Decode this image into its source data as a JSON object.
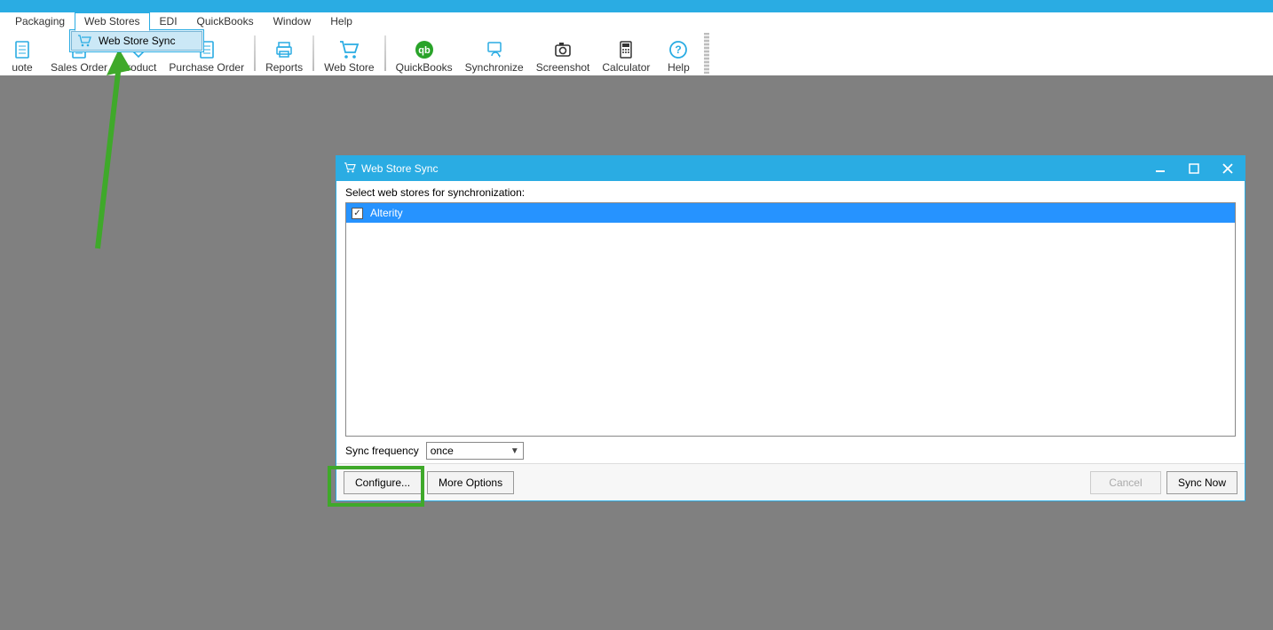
{
  "menubar": {
    "items": [
      {
        "label": "Packaging"
      },
      {
        "label": "Web Stores"
      },
      {
        "label": "EDI"
      },
      {
        "label": "QuickBooks"
      },
      {
        "label": "Window"
      },
      {
        "label": "Help"
      }
    ],
    "dropdown": {
      "item_label": "Web Store Sync"
    }
  },
  "toolbar": {
    "items": [
      {
        "name": "quote-button",
        "label": "uote",
        "color": "#2aace3",
        "icon": "doc"
      },
      {
        "name": "sales-order-button",
        "label": "Sales Order",
        "color": "#2aace3",
        "icon": "doc"
      },
      {
        "name": "product-button",
        "label": "Product",
        "color": "#2aace3",
        "icon": "tag"
      },
      {
        "name": "purchase-order-button",
        "label": "Purchase Order",
        "color": "#2aace3",
        "icon": "doc"
      },
      {
        "name": "reports-button",
        "label": "Reports",
        "color": "#2aace3",
        "icon": "printer",
        "sep_before": true
      },
      {
        "name": "web-store-button",
        "label": "Web Store",
        "color": "#2aace3",
        "icon": "cart",
        "sep_before": true
      },
      {
        "name": "quickbooks-button",
        "label": "QuickBooks",
        "color": "#29a329",
        "icon": "qb",
        "sep_before": true
      },
      {
        "name": "synchronize-button",
        "label": "Synchronize",
        "color": "#2aace3",
        "icon": "sync"
      },
      {
        "name": "screenshot-button",
        "label": "Screenshot",
        "color": "#333",
        "icon": "camera"
      },
      {
        "name": "calculator-button",
        "label": "Calculator",
        "color": "#333",
        "icon": "calc"
      },
      {
        "name": "help-button",
        "label": "Help",
        "color": "#2aace3",
        "icon": "help"
      }
    ]
  },
  "dialog": {
    "title": "Web Store Sync",
    "prompt": "Select web stores for synchronization:",
    "list_items": [
      {
        "label": "Alterity",
        "checked": true
      }
    ],
    "frequency_label": "Sync frequency",
    "frequency_value": "once",
    "buttons": {
      "configure": "Configure...",
      "more_options": "More Options",
      "cancel": "Cancel",
      "sync_now": "Sync Now"
    }
  }
}
